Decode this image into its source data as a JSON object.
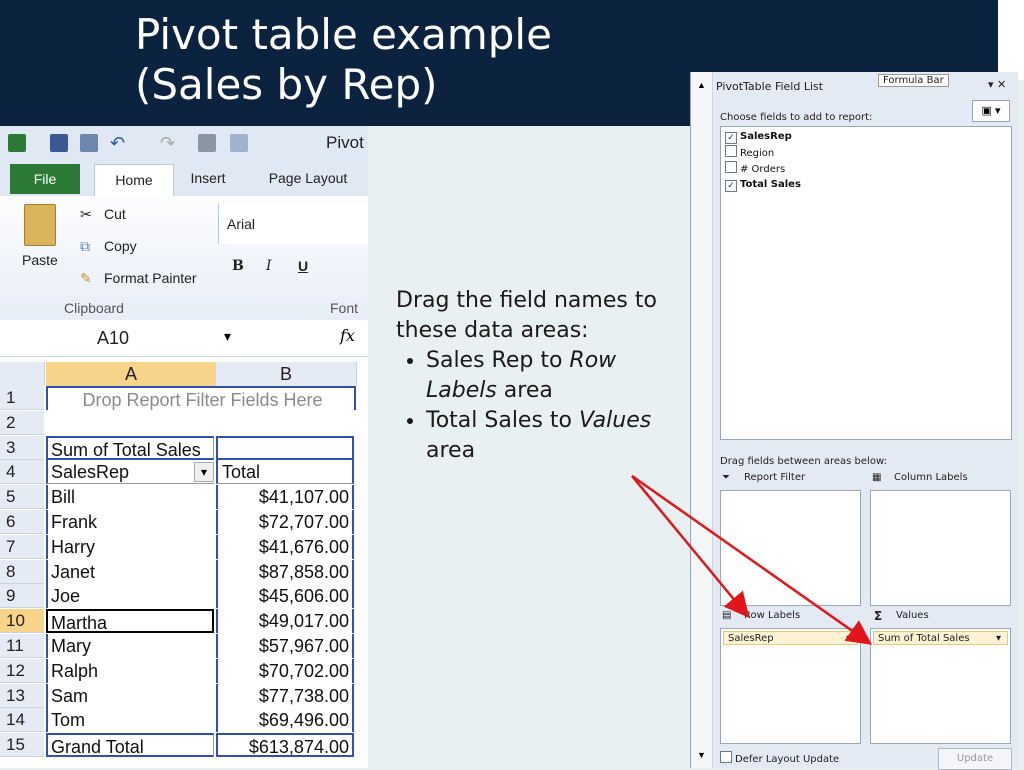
{
  "slide": {
    "title_line1": "Pivot table example",
    "title_line2": "(Sales by Rep)",
    "instructions": {
      "intro": "Drag the field names to these data areas:",
      "bullets": [
        {
          "text_before": "Sales Rep to ",
          "emphasis": "Row Labels",
          "text_after": " area"
        },
        {
          "text_before": "Total Sales to ",
          "emphasis": "Values",
          "text_after": " area"
        }
      ]
    }
  },
  "excel": {
    "window_title_fragment": "Pivot",
    "tabs": [
      "File",
      "Home",
      "Insert",
      "Page Layout"
    ],
    "clipboard": {
      "paste": "Paste",
      "cut": "Cut",
      "copy": "Copy",
      "format_painter": "Format Painter",
      "group": "Clipboard"
    },
    "font": {
      "name": "Arial",
      "group": "Font",
      "bold": "B",
      "italic": "I",
      "underline": "U"
    },
    "name_box": "A10",
    "fx": "fx",
    "columns": [
      "A",
      "B"
    ],
    "rows": [
      {
        "num": "1",
        "a": "Drop Report Filter Fields Here",
        "b": ""
      },
      {
        "num": "2",
        "a": "",
        "b": ""
      },
      {
        "num": "3",
        "a": "Sum of Total Sales",
        "b": ""
      },
      {
        "num": "4",
        "a": "SalesRep",
        "b": "Total"
      },
      {
        "num": "5",
        "a": "Bill",
        "b": "$41,107.00"
      },
      {
        "num": "6",
        "a": "Frank",
        "b": "$72,707.00"
      },
      {
        "num": "7",
        "a": "Harry",
        "b": "$41,676.00"
      },
      {
        "num": "8",
        "a": "Janet",
        "b": "$87,858.00"
      },
      {
        "num": "9",
        "a": "Joe",
        "b": "$45,606.00"
      },
      {
        "num": "10",
        "a": "Martha",
        "b": "$49,017.00"
      },
      {
        "num": "11",
        "a": "Mary",
        "b": "$57,967.00"
      },
      {
        "num": "12",
        "a": "Ralph",
        "b": "$70,702.00"
      },
      {
        "num": "13",
        "a": "Sam",
        "b": "$77,738.00"
      },
      {
        "num": "14",
        "a": "Tom",
        "b": "$69,496.00"
      },
      {
        "num": "15",
        "a": "Grand Total",
        "b": "$613,874.00"
      }
    ]
  },
  "field_list": {
    "title": "PivotTable Field List",
    "formula_bar_tooltip": "Formula Bar",
    "choose_label": "Choose fields to add to report:",
    "fields": [
      {
        "name": "SalesRep",
        "checked": true
      },
      {
        "name": "Region",
        "checked": false
      },
      {
        "name": "# Orders",
        "checked": false
      },
      {
        "name": "Total Sales",
        "checked": true
      }
    ],
    "drag_label": "Drag fields between areas below:",
    "areas": {
      "report_filter": "Report Filter",
      "column_labels": "Column Labels",
      "row_labels": "Row Labels",
      "values": "Values"
    },
    "row_chip": "SalesRep",
    "values_chip": "Sum of Total Sales",
    "defer_label": "Defer Layout Update",
    "update_label": "Update"
  },
  "colors": {
    "banner": "#0c2340",
    "arrow": "#e0161b",
    "excel_green": "#2c7a36"
  }
}
